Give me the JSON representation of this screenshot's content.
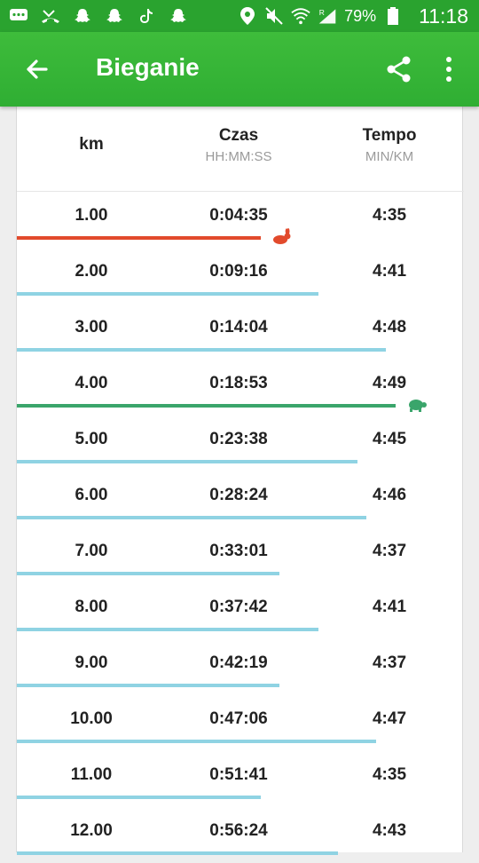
{
  "status_bar": {
    "battery": "79%",
    "time": "11:18",
    "signal_label": "R"
  },
  "app_bar": {
    "title": "Bieganie"
  },
  "table": {
    "headers": {
      "km": "km",
      "czas": "Czas",
      "czas_unit": "HH:MM:SS",
      "tempo": "Tempo",
      "tempo_unit": "MIN/KM"
    },
    "rows": [
      {
        "km": "1.00",
        "czas": "0:04:35",
        "tempo": "4:35",
        "pace_sec": 275,
        "marker": "fastest"
      },
      {
        "km": "2.00",
        "czas": "0:09:16",
        "tempo": "4:41",
        "pace_sec": 281,
        "marker": ""
      },
      {
        "km": "3.00",
        "czas": "0:14:04",
        "tempo": "4:48",
        "pace_sec": 288,
        "marker": ""
      },
      {
        "km": "4.00",
        "czas": "0:18:53",
        "tempo": "4:49",
        "pace_sec": 289,
        "marker": "slowest"
      },
      {
        "km": "5.00",
        "czas": "0:23:38",
        "tempo": "4:45",
        "pace_sec": 285,
        "marker": ""
      },
      {
        "km": "6.00",
        "czas": "0:28:24",
        "tempo": "4:46",
        "pace_sec": 286,
        "marker": ""
      },
      {
        "km": "7.00",
        "czas": "0:33:01",
        "tempo": "4:37",
        "pace_sec": 277,
        "marker": ""
      },
      {
        "km": "8.00",
        "czas": "0:37:42",
        "tempo": "4:41",
        "pace_sec": 281,
        "marker": ""
      },
      {
        "km": "9.00",
        "czas": "0:42:19",
        "tempo": "4:37",
        "pace_sec": 277,
        "marker": ""
      },
      {
        "km": "10.00",
        "czas": "0:47:06",
        "tempo": "4:47",
        "pace_sec": 287,
        "marker": ""
      },
      {
        "km": "11.00",
        "czas": "0:51:41",
        "tempo": "4:35",
        "pace_sec": 275,
        "marker": ""
      },
      {
        "km": "12.00",
        "czas": "0:56:24",
        "tempo": "4:43",
        "pace_sec": 283,
        "marker": ""
      }
    ]
  },
  "colors": {
    "fastest": "#e24a2c",
    "slowest": "#3aa56b",
    "normal": "#8fd3e3",
    "appbar": "#2fae33"
  }
}
